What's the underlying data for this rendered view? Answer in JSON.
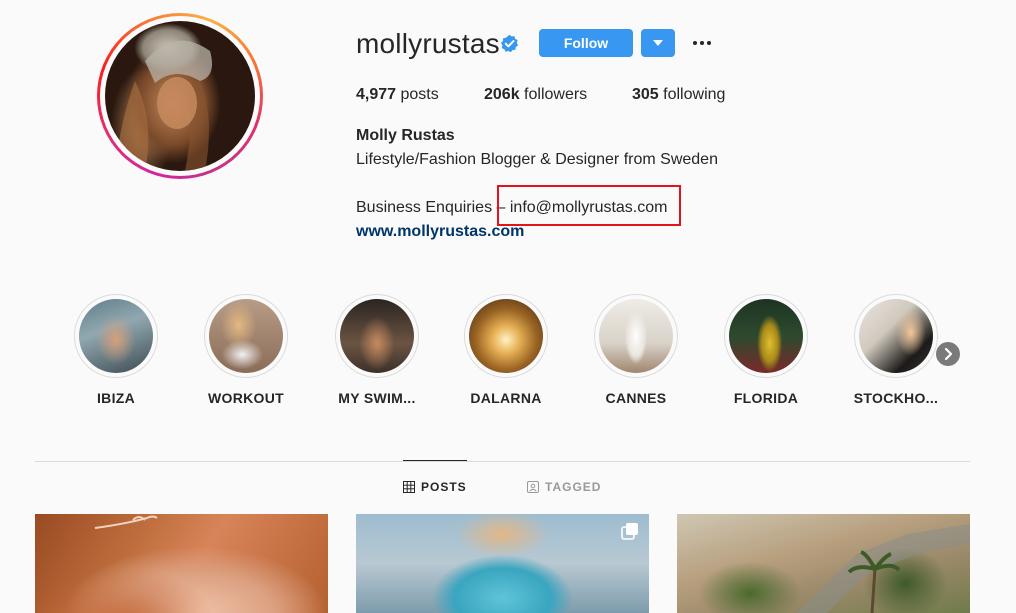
{
  "profile": {
    "username": "mollyrustas",
    "follow_label": "Follow",
    "full_name": "Molly Rustas",
    "bio": "Lifestyle/Fashion Blogger & Designer from Sweden",
    "business_line": "Business Enquiries – info@mollyrustas.com",
    "website": "www.mollyrustas.com",
    "icons": {
      "verified": "verified-badge-icon",
      "dropdown": "chevron-down-icon",
      "more": "more-horizontal-icon"
    },
    "colors": {
      "follow_blue": "#3897f0",
      "link_blue": "#003569",
      "annotation_red": "#e3131b"
    }
  },
  "stats": {
    "posts_count": "4,977",
    "posts_label": "posts",
    "followers_count": "206k",
    "followers_label": "followers",
    "following_count": "305",
    "following_label": "following"
  },
  "highlights": [
    {
      "label": "IBIZA"
    },
    {
      "label": "WORKOUT"
    },
    {
      "label": "MY SWIM..."
    },
    {
      "label": "DALARNA"
    },
    {
      "label": "CANNES"
    },
    {
      "label": "FLORIDA"
    },
    {
      "label": "STOCKHO..."
    }
  ],
  "tabs": {
    "posts": "POSTS",
    "tagged": "TAGGED"
  }
}
